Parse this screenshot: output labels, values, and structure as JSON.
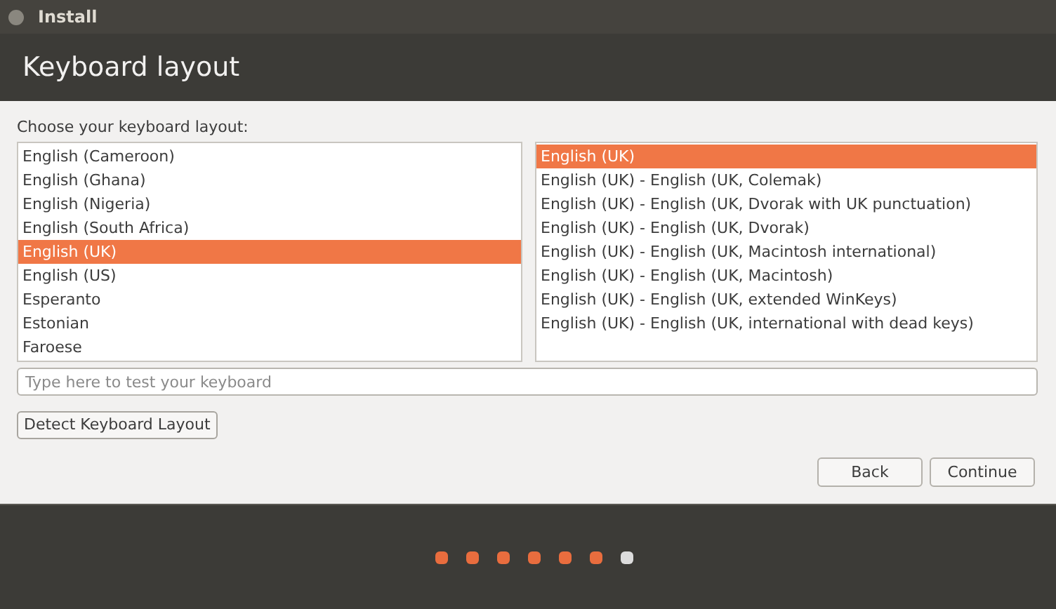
{
  "window": {
    "title": "Install"
  },
  "header": {
    "title": "Keyboard layout"
  },
  "prompt": "Choose your keyboard layout:",
  "layouts": [
    {
      "label": "English (Cameroon)",
      "selected": false
    },
    {
      "label": "English (Ghana)",
      "selected": false
    },
    {
      "label": "English (Nigeria)",
      "selected": false
    },
    {
      "label": "English (South Africa)",
      "selected": false
    },
    {
      "label": "English (UK)",
      "selected": true
    },
    {
      "label": "English (US)",
      "selected": false
    },
    {
      "label": "Esperanto",
      "selected": false
    },
    {
      "label": "Estonian",
      "selected": false
    },
    {
      "label": "Faroese",
      "selected": false
    }
  ],
  "variants": [
    {
      "label": "English (UK)",
      "selected": true
    },
    {
      "label": "English (UK) - English (UK, Colemak)",
      "selected": false
    },
    {
      "label": "English (UK) - English (UK, Dvorak with UK punctuation)",
      "selected": false
    },
    {
      "label": "English (UK) - English (UK, Dvorak)",
      "selected": false
    },
    {
      "label": "English (UK) - English (UK, Macintosh international)",
      "selected": false
    },
    {
      "label": "English (UK) - English (UK, Macintosh)",
      "selected": false
    },
    {
      "label": "English (UK) - English (UK, extended WinKeys)",
      "selected": false
    },
    {
      "label": "English (UK) - English (UK, international with dead keys)",
      "selected": false
    }
  ],
  "test_field": {
    "placeholder": "Type here to test your keyboard"
  },
  "detect_button": "Detect Keyboard Layout",
  "buttons": [
    "Back",
    "Continue"
  ],
  "steps": [
    {
      "current": false
    },
    {
      "current": false
    },
    {
      "current": false
    },
    {
      "current": false
    },
    {
      "current": false
    },
    {
      "current": false
    },
    {
      "current": true
    }
  ]
}
